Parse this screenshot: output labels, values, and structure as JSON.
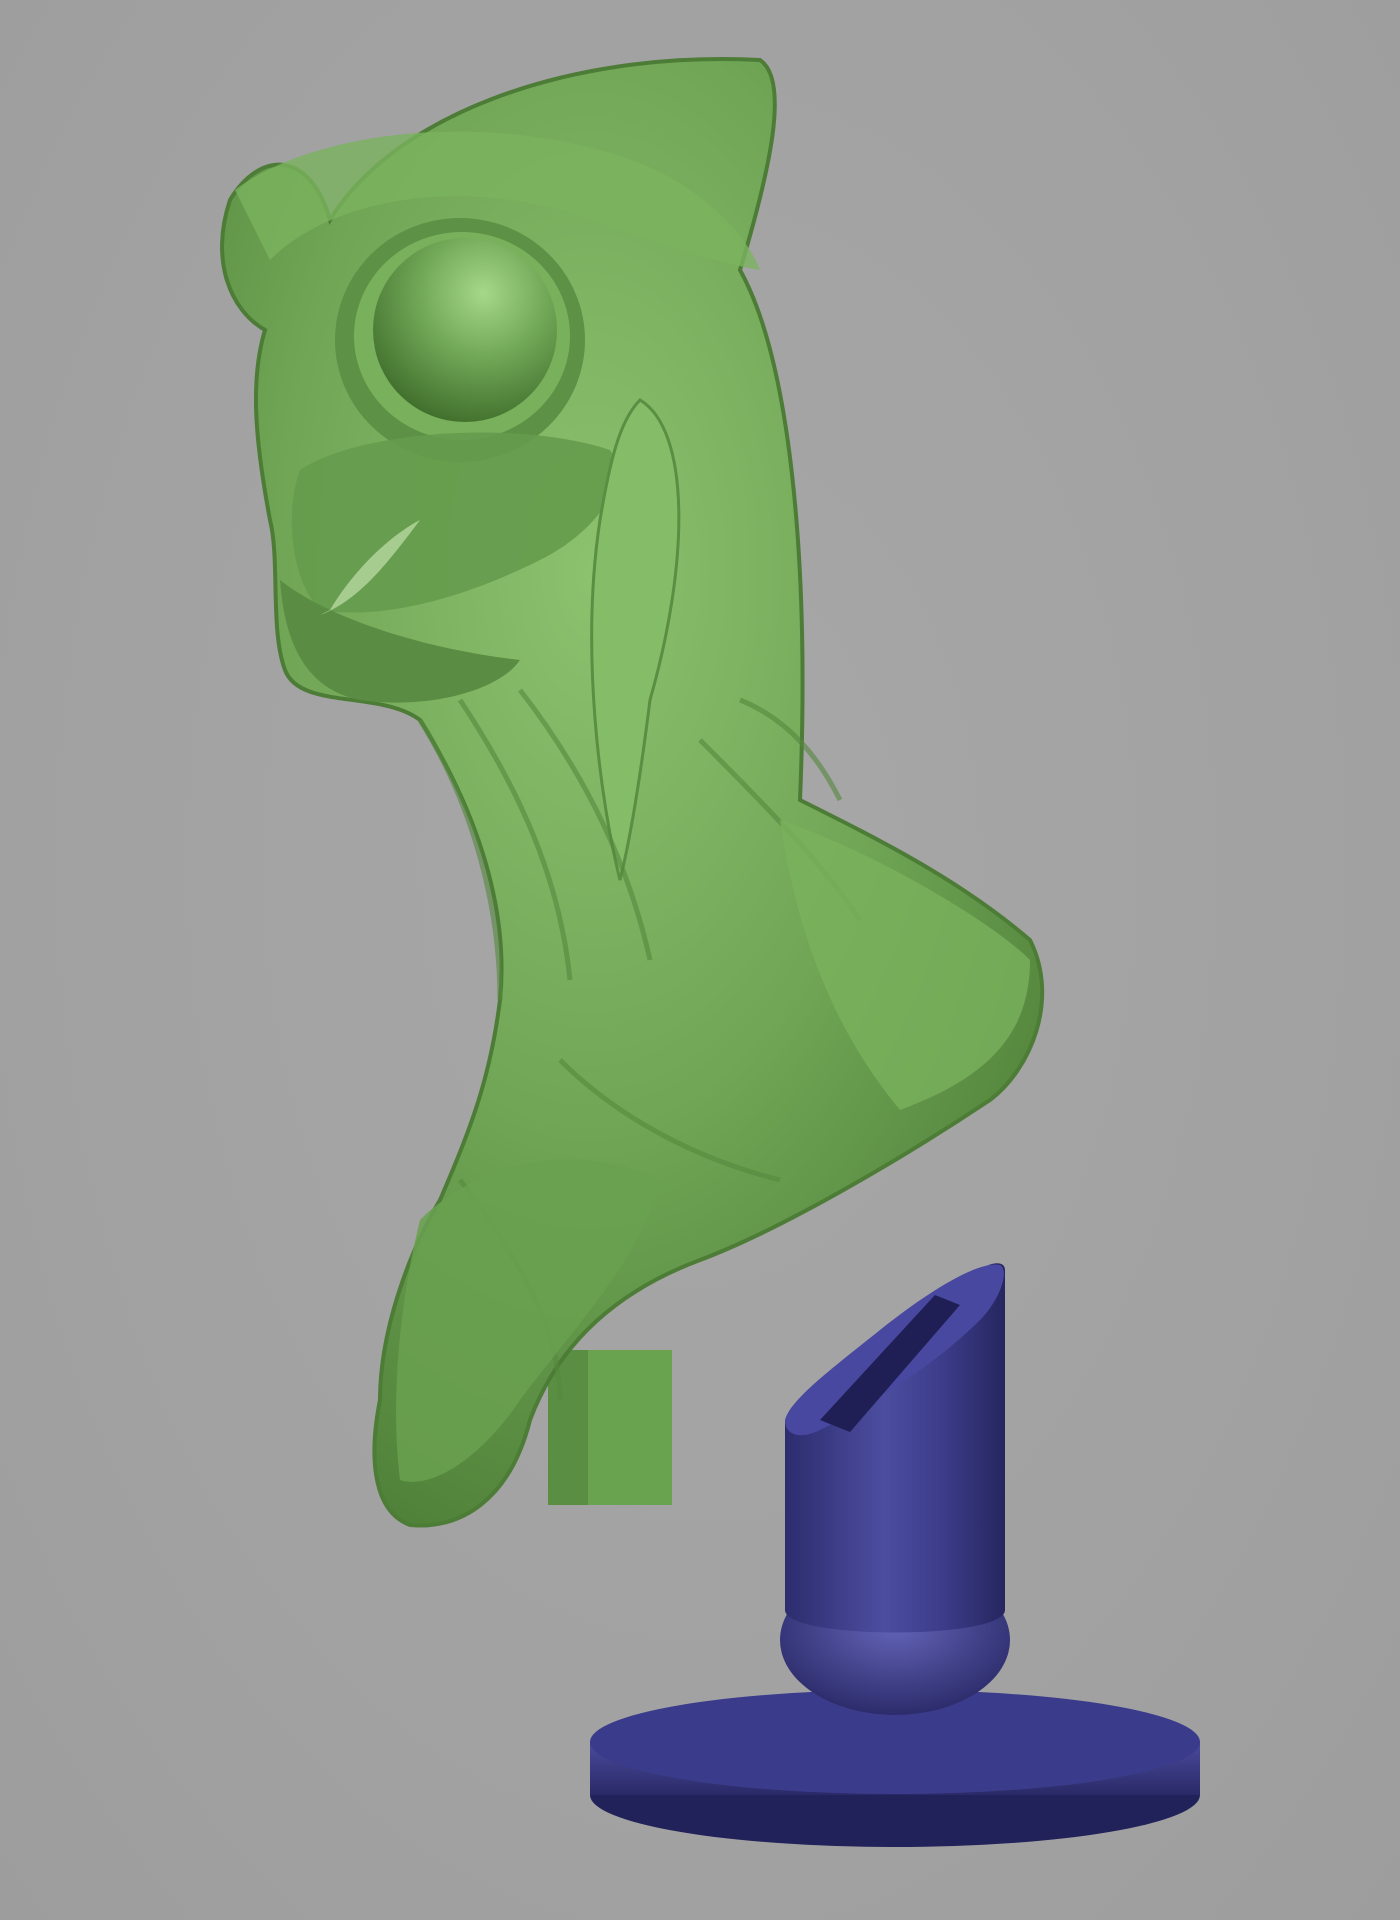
{
  "viewport": {
    "background_color": "#a3a3a3"
  },
  "scene": {
    "objects": [
      {
        "name": "alien-bust",
        "material_color": "#6fa555",
        "shade_dark": "#4a7a34",
        "shade_light": "#93c878"
      },
      {
        "name": "display-stand",
        "material_color": "#3f3f8c",
        "shade_dark": "#2a2a66",
        "shade_light": "#5a5aae"
      },
      {
        "name": "mounting-peg",
        "material_color": "#6fa555"
      }
    ]
  }
}
